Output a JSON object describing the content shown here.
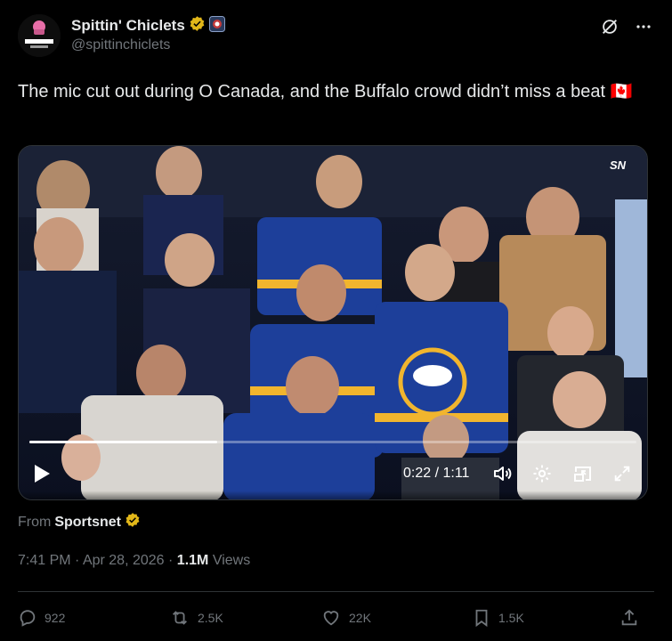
{
  "author": {
    "display_name": "Spittin' Chiclets",
    "handle": "@spittinchiclets",
    "avatar_text": "SPITTIN' CHICLETS"
  },
  "tweet": {
    "text": "The mic cut out during O Canada, and the Buffalo crowd didn’t miss a beat 🇨🇦"
  },
  "video": {
    "time": "0:22 / 1:11",
    "progress": 0.31,
    "network_bug": "SN"
  },
  "source": {
    "prefix": "From",
    "name": "Sportsnet"
  },
  "meta": {
    "time": "7:41 PM",
    "separator": "·",
    "date": "Apr 28, 2026",
    "views_count": "1.1M",
    "views_label": "Views"
  },
  "actions": {
    "replies": "922",
    "reposts": "2.5K",
    "likes": "22K",
    "bookmarks": "1.5K"
  },
  "colors": {
    "verified_gold": "#e2b719",
    "text_primary": "#e7e9ea",
    "text_secondary": "#71767b",
    "divider": "#2f3336",
    "sabres_blue": "#1d3f9a",
    "sabres_gold": "#f1b52e"
  }
}
